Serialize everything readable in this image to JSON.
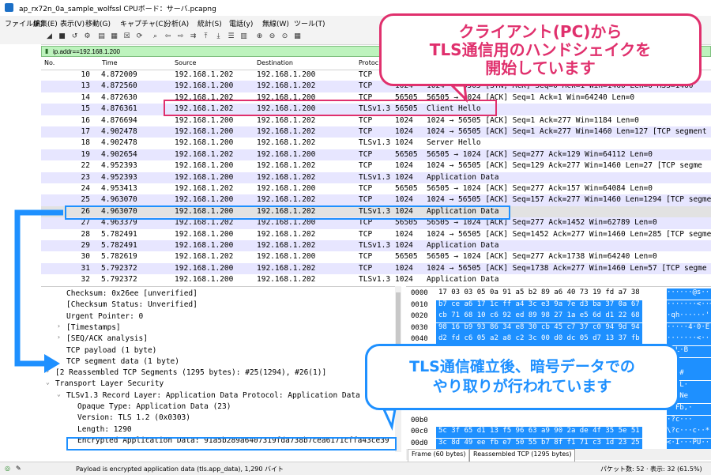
{
  "window": {
    "title": "ap_rx72n_0a_sample_wolfssl CPUボード：サーバ.pcapng"
  },
  "menu": [
    "ファイル(F)",
    "編集(E)",
    "表示(V)",
    "移動(G)",
    "キャプチャ(C)",
    "分析(A)",
    "統計(S)",
    "電話(y)",
    "無線(W)",
    "ツール(T)"
  ],
  "filter": {
    "value": "ip.addr==192.168.1.200"
  },
  "columns": {
    "no": "No.",
    "time": "Time",
    "source": "Source",
    "destination": "Destination",
    "protocol": "Protoc"
  },
  "packets": [
    {
      "no": "10",
      "time": "4.872009",
      "src": "192.168.1.202",
      "dst": "192.168.1.200",
      "proto": "TCP",
      "len": "",
      "info": ""
    },
    {
      "no": "13",
      "time": "4.872560",
      "src": "192.168.1.200",
      "dst": "192.168.1.202",
      "proto": "TCP",
      "len": "1024",
      "info": "1024 → 56505 [SYN, ACK] Seq=0 Ack=1 Win=1460 Len=0 MSS=1460"
    },
    {
      "no": "14",
      "time": "4.872630",
      "src": "192.168.1.202",
      "dst": "192.168.1.200",
      "proto": "TCP",
      "len": "56505",
      "info": "56505 → 1024 [ACK] Seq=1 Ack=1 Win=64240 Len=0"
    },
    {
      "no": "15",
      "time": "4.876361",
      "src": "192.168.1.202",
      "dst": "192.168.1.200",
      "proto": "TLSv1.3",
      "len": "56505",
      "info": "Client Hello"
    },
    {
      "no": "16",
      "time": "4.876694",
      "src": "192.168.1.200",
      "dst": "192.168.1.202",
      "proto": "TCP",
      "len": "1024",
      "info": "1024 → 56505 [ACK] Seq=1 Ack=277 Win=1184 Len=0"
    },
    {
      "no": "17",
      "time": "4.902478",
      "src": "192.168.1.200",
      "dst": "192.168.1.202",
      "proto": "TCP",
      "len": "1024",
      "info": "1024 → 56505 [ACK] Seq=1 Ack=277 Win=1460 Len=127 [TCP segment"
    },
    {
      "no": "18",
      "time": "4.902478",
      "src": "192.168.1.200",
      "dst": "192.168.1.202",
      "proto": "TLSv1.3",
      "len": "1024",
      "info": "Server Hello"
    },
    {
      "no": "19",
      "time": "4.902654",
      "src": "192.168.1.202",
      "dst": "192.168.1.200",
      "proto": "TCP",
      "len": "56505",
      "info": "56505 → 1024 [ACK] Seq=277 Ack=129 Win=64112 Len=0"
    },
    {
      "no": "22",
      "time": "4.952393",
      "src": "192.168.1.200",
      "dst": "192.168.1.202",
      "proto": "TCP",
      "len": "1024",
      "info": "1024 → 56505 [ACK] Seq=129 Ack=277 Win=1460 Len=27 [TCP segme"
    },
    {
      "no": "23",
      "time": "4.952393",
      "src": "192.168.1.200",
      "dst": "192.168.1.202",
      "proto": "TLSv1.3",
      "len": "1024",
      "info": "Application Data"
    },
    {
      "no": "24",
      "time": "4.953413",
      "src": "192.168.1.202",
      "dst": "192.168.1.200",
      "proto": "TCP",
      "len": "56505",
      "info": "56505 → 1024 [ACK] Seq=277 Ack=157 Win=64084 Len=0"
    },
    {
      "no": "25",
      "time": "4.963070",
      "src": "192.168.1.200",
      "dst": "192.168.1.202",
      "proto": "TCP",
      "len": "1024",
      "info": "1024 → 56505 [ACK] Seq=157 Ack=277 Win=1460 Len=1294 [TCP segme"
    },
    {
      "no": "26",
      "time": "4.963070",
      "src": "192.168.1.200",
      "dst": "192.168.1.202",
      "proto": "TLSv1.3",
      "len": "1024",
      "info": "Application Data"
    },
    {
      "no": "27",
      "time": "4.963379",
      "src": "192.168.1.202",
      "dst": "192.168.1.200",
      "proto": "TCP",
      "len": "56505",
      "info": "56505 → 1024 [ACK] Seq=277 Ack=1452 Win=62789 Len=0"
    },
    {
      "no": "28",
      "time": "5.782491",
      "src": "192.168.1.200",
      "dst": "192.168.1.202",
      "proto": "TCP",
      "len": "1024",
      "info": "1024 → 56505 [ACK] Seq=1452 Ack=277 Win=1460 Len=285 [TCP segme"
    },
    {
      "no": "29",
      "time": "5.782491",
      "src": "192.168.1.200",
      "dst": "192.168.1.202",
      "proto": "TLSv1.3",
      "len": "1024",
      "info": "Application Data"
    },
    {
      "no": "30",
      "time": "5.782619",
      "src": "192.168.1.202",
      "dst": "192.168.1.200",
      "proto": "TCP",
      "len": "56505",
      "info": "56505 → 1024 [ACK] Seq=277 Ack=1738 Win=64240 Len=0"
    },
    {
      "no": "31",
      "time": "5.792372",
      "src": "192.168.1.200",
      "dst": "192.168.1.202",
      "proto": "TCP",
      "len": "1024",
      "info": "1024 → 56505 [ACK] Seq=1738 Ack=277 Win=1460 Len=57 [TCP segme"
    },
    {
      "no": "32",
      "time": "5.792372",
      "src": "192.168.1.200",
      "dst": "192.168.1.202",
      "proto": "TLSv1.3",
      "len": "1024",
      "info": "Application Data"
    }
  ],
  "details": [
    {
      "indent": 0,
      "arrow": "",
      "text": "Checksum: 0x26ee [unverified]"
    },
    {
      "indent": 0,
      "arrow": "",
      "text": "[Checksum Status: Unverified]"
    },
    {
      "indent": 0,
      "arrow": "",
      "text": "Urgent Pointer: 0"
    },
    {
      "indent": 0,
      "arrow": ">",
      "text": "[Timestamps]"
    },
    {
      "indent": 0,
      "arrow": ">",
      "text": "[SEQ/ACK analysis]"
    },
    {
      "indent": 0,
      "arrow": "",
      "text": "TCP payload (1 byte)"
    },
    {
      "indent": 0,
      "arrow": "",
      "text": "TCP segment data (1 byte)"
    },
    {
      "indent": -1,
      "arrow": ">",
      "text": "[2 Reassembled TCP Segments (1295 bytes): #25(1294), #26(1)]"
    },
    {
      "indent": -1,
      "arrow": "v",
      "text": "Transport Layer Security"
    },
    {
      "indent": 0,
      "arrow": "v",
      "text": "TLSv1.3 Record Layer: Application Data Protocol: Application Data"
    },
    {
      "indent": 1,
      "arrow": "",
      "text": "Opaque Type: Application Data (23)"
    },
    {
      "indent": 1,
      "arrow": "",
      "text": "Version: TLS 1.2 (0x0303)"
    },
    {
      "indent": 1,
      "arrow": "",
      "text": "Length: 1290"
    },
    {
      "indent": 1,
      "arrow": "",
      "text": "Encrypted Application Data: 91a5b289a6407319fda738b7cea6171cffa43ce39"
    }
  ],
  "bytes": [
    {
      "off": "0000",
      "hex": "17 03 03 05 0a 91 a5 b2  89 a6 40 73 19 fd a7 38",
      "asc": "······@s···8"
    },
    {
      "off": "0010",
      "hex": "b7 ce a6 17 1c ff a4 3c  e3 9a 7e d3 ba 37 0a 67",
      "asc": "·······<··~··7·g"
    },
    {
      "off": "0020",
      "hex": "cb 71 68 10 c6 92 ed 89  98 27 1a e5 6d d1 22 68",
      "asc": "·qh······'··m·\"h"
    },
    {
      "off": "0030",
      "hex": "98 16 b9 93 86 34 e8 30  cb 45 c7 37 c0 94 9d 94",
      "asc": "·····4·0·E·7····"
    },
    {
      "off": "0040",
      "hex": "d2 fd c6 05 a2 a8 c2 3c  00 d0 dc 05 d7 13 37 fb",
      "asc": "·······<······7·"
    },
    {
      "off": "0050",
      "hex": "",
      "asc": "··L·B"
    },
    {
      "off": "0060",
      "hex": "",
      "asc": ""
    },
    {
      "off": "0070",
      "hex": "",
      "asc": "·T;#"
    },
    {
      "off": "0080",
      "hex": "",
      "asc": "#·qL·"
    },
    {
      "off": "0090",
      "hex": "",
      "asc": "y?·Ne"
    },
    {
      "off": "00a0",
      "hex": "",
      "asc": "··Fb,·"
    },
    {
      "off": "00b0",
      "hex": "",
      "asc": "·?c···"
    },
    {
      "off": "00c0",
      "hex": "5c 3f 65 d1 13 f5 96 63  a9 90 2a de 4f 35 5e 51",
      "asc": "\\?c···c··*·O5^Q"
    },
    {
      "off": "00d0",
      "hex": "3c 8d 49 ee fb e7 50 55  b7 8f f1 71 c3 1d 23 25",
      "asc": "<·I···PU···q··#%"
    },
    {
      "off": "00e0",
      "hex": "2b 30 53 db e9 a1 81 0d  bf 4a a3 95 94 da b9 7a",
      "asc": "+0S······J·····z"
    }
  ],
  "bytetabs": [
    "Frame (60 bytes)",
    "Reassembled TCP (1295 bytes)"
  ],
  "status": {
    "message": "Payload is encrypted application data (tls.app_data), 1,290 バイト",
    "packets": "パケット数: 52 · 表示: 32 (61.5%)"
  },
  "callouts": {
    "handshake": [
      "クライアント(PC)から",
      "TLS通信用のハンドシェイクを",
      "開始しています"
    ],
    "encrypted": [
      "TLS通信確立後、暗号データでの",
      "やり取りが行われています"
    ]
  },
  "colors": {
    "pink": "#e0306d",
    "blue": "#1e90ff",
    "filter_green": "#bdf3bd",
    "row_alt": "#e7e6ff"
  }
}
